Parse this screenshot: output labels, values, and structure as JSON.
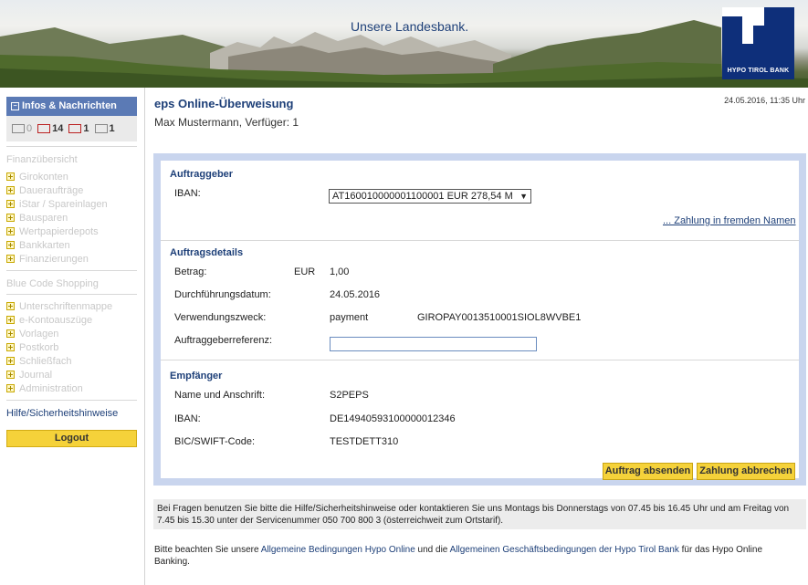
{
  "header": {
    "tagline": "Unsere Landesbank.",
    "logo_text": "HYPO TIROL BANK"
  },
  "sidebar": {
    "info_title": "Infos & Nachrichten",
    "counters": [
      {
        "icon": "mail-icon",
        "count": "0"
      },
      {
        "icon": "inbox-message-icon",
        "count": "14"
      },
      {
        "icon": "transfer-icon",
        "count": "1"
      },
      {
        "icon": "document-list-icon",
        "count": "1"
      }
    ],
    "section1_title": "Finanzübersicht",
    "section1_items": [
      "Girokonten",
      "Daueraufträge",
      "iStar / Spareinlagen",
      "Bausparen",
      "Wertpapierdepots",
      "Bankkarten",
      "Finanzierungen"
    ],
    "section2_title": "Blue Code Shopping",
    "section3_items": [
      "Unterschriftenmappe",
      "e-Kontoauszüge",
      "Vorlagen",
      "Postkorb",
      "Schließfach",
      "Journal",
      "Administration"
    ],
    "help_link": "Hilfe/Sicherheitshinweise",
    "logout_label": "Logout"
  },
  "main": {
    "title": "eps Online-Überweisung",
    "timestamp": "24.05.2016, 11:35 Uhr",
    "user_line": "Max Mustermann, Verfüger: 1"
  },
  "form": {
    "auftraggeber": {
      "title": "Auftraggeber",
      "iban_label": "IBAN:",
      "iban_selected": "AT160010000001100001  EUR 278,54  M",
      "foreign_link": "... Zahlung in fremden Namen"
    },
    "details": {
      "title": "Auftragsdetails",
      "betrag_label": "Betrag:",
      "currency": "EUR",
      "amount": "1,00",
      "datum_label": "Durchführungsdatum:",
      "datum_value": "24.05.2016",
      "zweck_label": "Verwendungszweck:",
      "zweck_value": "payment",
      "zweck_ref": "GIROPAY0013510001SIOL8WVBE1",
      "referenz_label": "Auftraggeberreferenz:",
      "referenz_value": ""
    },
    "empfaenger": {
      "title": "Empfänger",
      "name_label": "Name und Anschrift:",
      "name_value": "S2PEPS",
      "iban_label": "IBAN:",
      "iban_value": "DE14940593100000012346",
      "bic_label": "BIC/SWIFT-Code:",
      "bic_value": "TESTDETT310"
    },
    "submit_label": "Auftrag absenden",
    "cancel_label": "Zahlung abbrechen"
  },
  "notice": "Bei Fragen benutzen Sie bitte die Hilfe/Sicherheitshinweise oder kontaktieren Sie uns Montags bis Donnerstags von 07.45 bis 16.45 Uhr und am Freitag von 7.45 bis 15.30 unter der Servicenummer 050 700 800 3 (österreichweit zum Ortstarif).",
  "terms": {
    "prefix": "Bitte beachten Sie unsere ",
    "link1": "Allgemeine Bedingungen Hypo Online",
    "middle": " und die ",
    "link2": "Allgemeinen Geschäftsbedingungen der Hypo Tirol Bank",
    "suffix": " für das Hypo Online Banking."
  },
  "colors": {
    "brand_blue": "#0e2f7a",
    "title_blue": "#1d3f78",
    "button_yellow": "#f5d23a",
    "frame_blue": "#c9d5ee"
  }
}
